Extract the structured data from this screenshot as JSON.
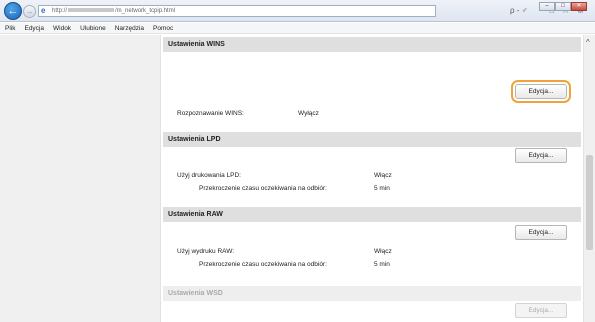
{
  "window": {
    "controls": [
      "–",
      "□",
      "✕"
    ]
  },
  "addressbar": {
    "prefix": "http://",
    "suffix": "/m_network_tcpip.html",
    "tools": "ρ - ♂"
  },
  "menubar": {
    "items": [
      "Plik",
      "Edycja",
      "Widok",
      "Ulubione",
      "Narzędzia",
      "Pomoc"
    ]
  },
  "sections": {
    "wins": {
      "title": "Ustawienia WINS",
      "edit_label": "Edycja...",
      "rows": [
        {
          "label": "Rozpoznawanie WINS:",
          "value": "Wyłącz"
        }
      ]
    },
    "lpd": {
      "title": "Ustawienia LPD",
      "edit_label": "Edycja...",
      "rows": [
        {
          "label": "Użyj drukowania LPD:",
          "value": "Włącz"
        },
        {
          "label": "Przekroczenie czasu oczekiwania na odbiór:",
          "value": "5 min"
        }
      ]
    },
    "raw": {
      "title": "Ustawienia RAW",
      "edit_label": "Edycja...",
      "rows": [
        {
          "label": "Użyj wydruku RAW:",
          "value": "Włącz"
        },
        {
          "label": "Przekroczenie czasu oczekiwania na odbiór:",
          "value": "5 min"
        }
      ]
    },
    "wsd": {
      "title": "Ustawienia WSD",
      "edit_label": "Edycja..."
    }
  },
  "icons": {
    "back": "back-arrow-icon",
    "forward": "forward-arrow-icon",
    "page": "ie-page-icon",
    "home": "home-icon",
    "favorites": "star-icon",
    "settings": "gear-icon"
  }
}
